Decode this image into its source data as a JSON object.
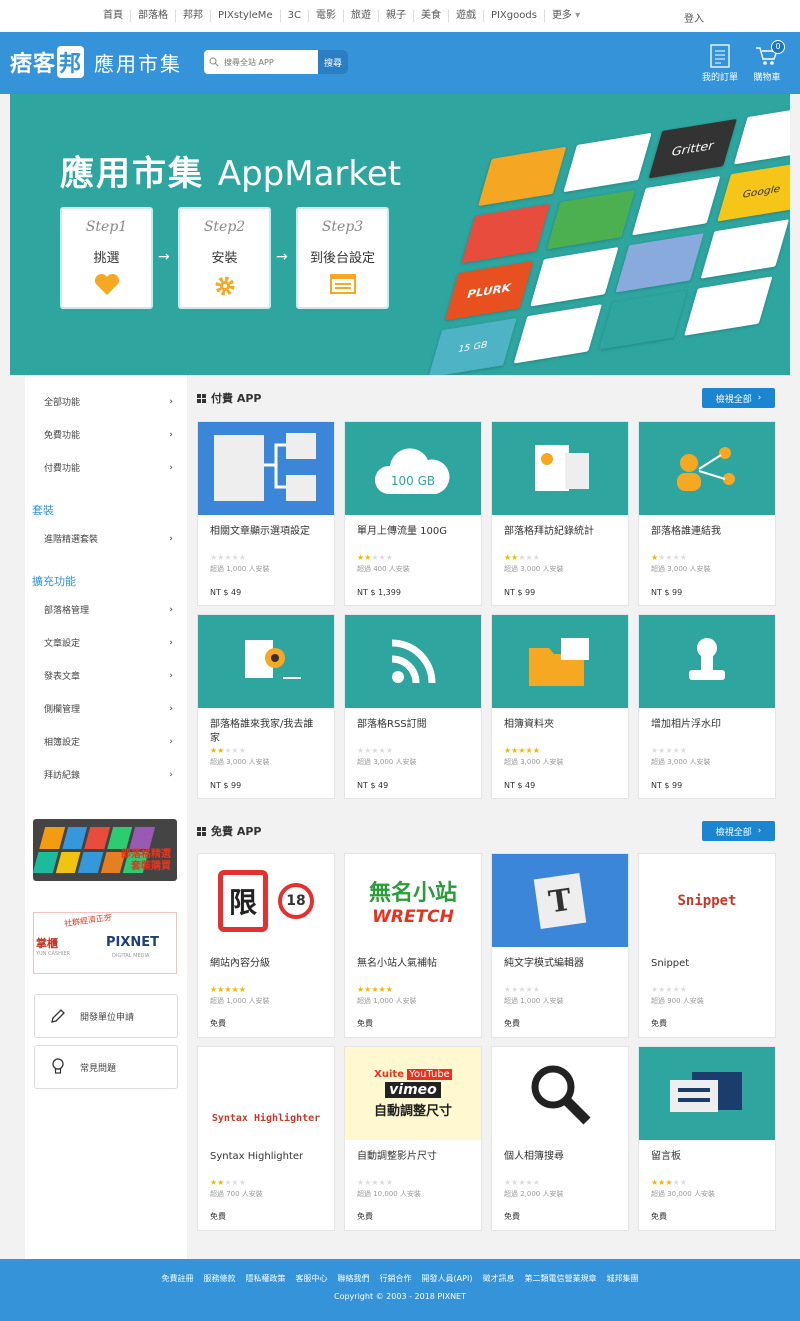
{
  "topnav": {
    "items": [
      "首頁",
      "部落格",
      "邦邦",
      "PIXstyleMe",
      "3C",
      "電影",
      "旅遊",
      "親子",
      "美食",
      "遊戲",
      "PIXgoods",
      "更多"
    ],
    "login": "登入"
  },
  "header": {
    "logo": {
      "pre": "痞客",
      "bang": "邦"
    },
    "title": "應用市集",
    "search_placeholder": "搜尋全站 APP",
    "search_button": "搜尋",
    "orders_label": "我的訂單",
    "cart_label": "購物車",
    "cart_count": "0",
    "colors": {
      "primary": "#3493d9",
      "button": "#2a7fc4"
    }
  },
  "banner": {
    "title_zh": "應用市集",
    "title_en": "AppMarket",
    "steps": [
      {
        "label": "Step1",
        "text": "挑選",
        "icon": "heart-icon"
      },
      {
        "label": "Step2",
        "text": "安裝",
        "icon": "gear-icon"
      },
      {
        "label": "Step3",
        "text": "到後台設定",
        "icon": "list-icon"
      }
    ],
    "tile_labels": {
      "plurk": "PLURK",
      "gritter": "Gritter",
      "cloud": "15 GB",
      "google": "Google"
    }
  },
  "sidebar": {
    "top_items": [
      "全部功能",
      "免費功能",
      "付費功能"
    ],
    "group1_title": "套裝",
    "group1_items": [
      "進階精選套裝"
    ],
    "group2_title": "擴充功能",
    "group2_items": [
      "部落格管理",
      "文章設定",
      "發表文章",
      "側欄管理",
      "相簿設定",
      "拜訪紀錄"
    ],
    "promo1": {
      "line1": "部落格精選",
      "line2": "套裝購買"
    },
    "promo2": {
      "left": "掌櫃",
      "sub": "YUN CASHIER",
      "sign": "社群經濟正夯",
      "right": "PIXNET",
      "right_sub": "DIGITAL MEDIA"
    },
    "btn_dev": "開發單位申請",
    "btn_faq": "常見問題"
  },
  "paid": {
    "title": "付費 APP",
    "view_all": "檢視全部",
    "cards": [
      {
        "name": "相關文章顯示選項設定",
        "stars": 0,
        "installs": "超過 1,000 人安裝",
        "price": "NT $ 49",
        "icon": "doc-flow-icon",
        "cloud_text": ""
      },
      {
        "name": "單月上傳流量 100G",
        "stars": 2,
        "installs": "超過 400 人安裝",
        "price": "NT $ 1,399",
        "icon": "cloud-upload-icon",
        "cloud_text": "100 GB"
      },
      {
        "name": "部落格拜訪紀錄統計",
        "stars": 1.5,
        "installs": "超過 3,000 人安裝",
        "price": "NT $ 99",
        "icon": "report-icon",
        "cloud_text": ""
      },
      {
        "name": "部落格誰連結我",
        "stars": 1,
        "installs": "超過 3,000 人安裝",
        "price": "NT $ 99",
        "icon": "people-link-icon",
        "cloud_text": ""
      },
      {
        "name": "部落格誰來我家/我去誰家",
        "stars": 2,
        "installs": "超過 3,000 人安裝",
        "price": "NT $ 99",
        "icon": "visitor-icon",
        "cloud_text": ""
      },
      {
        "name": "部落格RSS訂閱",
        "stars": 0,
        "installs": "超過 3,000 人安裝",
        "price": "NT $ 49",
        "icon": "rss-icon",
        "cloud_text": ""
      },
      {
        "name": "相簿資料夾",
        "stars": 5,
        "installs": "超過 3,000 人安裝",
        "price": "NT $ 49",
        "icon": "folder-icon",
        "cloud_text": ""
      },
      {
        "name": "增加相片浮水印",
        "stars": 0,
        "installs": "超過 3,000 人安裝",
        "price": "NT $ 99",
        "icon": "stamp-icon",
        "cloud_text": ""
      }
    ]
  },
  "free": {
    "title": "免費 APP",
    "view_all": "檢視全部",
    "cards": [
      {
        "name": "網站內容分級",
        "stars": 5,
        "installs": "超過 1,000 人安裝",
        "price": "免費",
        "icon": "rating-lock-icon"
      },
      {
        "name": "無名小站人氣補帖",
        "stars": 5,
        "installs": "超過 1,000 人安裝",
        "price": "免費",
        "icon": "wretch-icon"
      },
      {
        "name": "純文字模式編輯器",
        "stars": 0,
        "installs": "超過 1,000 人安裝",
        "price": "免費",
        "icon": "text-editor-icon"
      },
      {
        "name": "Snippet",
        "stars": 0,
        "installs": "超過 900 人安裝",
        "price": "免費",
        "icon": "snippet-icon"
      },
      {
        "name": "Syntax Highlighter",
        "stars": 1.5,
        "installs": "超過 700 人安裝",
        "price": "免費",
        "icon": "syntax-icon"
      },
      {
        "name": "自動調整影片尺寸",
        "stars": 0,
        "installs": "超過 10,000 人安裝",
        "price": "免費",
        "icon": "video-resize-icon"
      },
      {
        "name": "個人相簿搜尋",
        "stars": 0,
        "installs": "超過 2,000 人安裝",
        "price": "免費",
        "icon": "magnifier-icon"
      },
      {
        "name": "留言板",
        "stars": 3,
        "installs": "超過 30,000 人安裝",
        "price": "免費",
        "icon": "message-board-icon"
      }
    ],
    "image_texts": {
      "rating_lock": "限",
      "rating_18": "18",
      "wretch_top": "無名小站",
      "wretch_bottom": "WRETCH",
      "snippet": "Snippet",
      "syntax": "Syntax Highlighter",
      "xuite": "Xuite",
      "youtube": "YouTube",
      "vimeo": "vimeo",
      "resize": "自動調整尺寸",
      "t_letter": "T"
    }
  },
  "footer": {
    "links": [
      "免費註冊",
      "服務條款",
      "隱私權政策",
      "客服中心",
      "聯絡我們",
      "行銷合作",
      "開發人員(API)",
      "徵才訊息",
      "第二類電信營業規章",
      "城邦集團"
    ],
    "copyright": "Copyright © 2003 - 2018 PIXNET"
  }
}
